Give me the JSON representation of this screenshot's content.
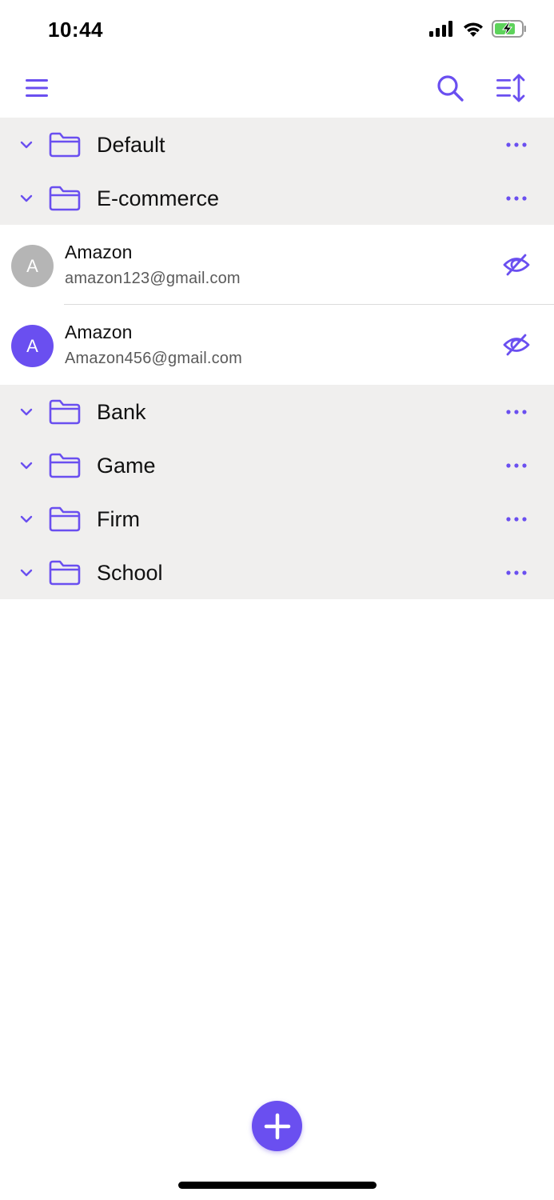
{
  "status_bar": {
    "time": "10:44"
  },
  "colors": {
    "accent": "#6a4ff0",
    "folder_bg": "#f0efee",
    "avatar_inactive": "#b5b5b5",
    "avatar_active": "#6a4ff0",
    "battery_fill": "#5dd35b"
  },
  "toolbar": {
    "menu_icon": "hamburger-menu-icon",
    "search_icon": "search-icon",
    "sort_icon": "sort-icon"
  },
  "folders_top": [
    {
      "label": "Default"
    },
    {
      "label": "E-commerce"
    }
  ],
  "entries": [
    {
      "initial": "A",
      "title": "Amazon",
      "subtitle": "amazon123@gmail.com",
      "avatar": "inactive"
    },
    {
      "initial": "A",
      "title": "Amazon",
      "subtitle": "Amazon456@gmail.com",
      "avatar": "active"
    }
  ],
  "folders_bottom": [
    {
      "label": "Bank"
    },
    {
      "label": "Game"
    },
    {
      "label": "Firm"
    },
    {
      "label": "School"
    }
  ],
  "fab": {
    "icon": "plus-icon"
  }
}
